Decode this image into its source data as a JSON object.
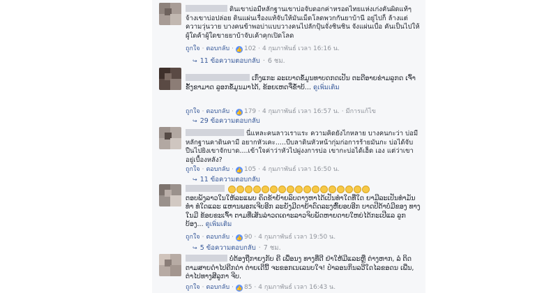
{
  "comments": [
    {
      "text": "ดินเขาบ่อมีหลักฐานเขาบ่อจับดอกค่าหรอดไทยแห่งเก่งคันผิดแท้ๆ จ้างเขาบ่อปล่อย ดินแผ่นเรื่องแท้จับให้มันเม็ดโลดพวกกันยาบ้านี อยู่ไปก็ ล้างแต่ความวุ่นวาย บางคนข้าพอบ่าแบบวางคนไปลักปุ้นจั่งชินชิน จังแผ่นเบื่อ คันเป็นไปให้ผู้ใดค้าผู้ใดขายยาบ้าจับเค้าคุกเปิดโลด",
      "more": "",
      "like": "ถูกใจ",
      "reply": "ตอบกลับ",
      "count": "102",
      "time": "4 กุมภาพันธ์ เวลา 16:16 น.",
      "edited": "",
      "replies": "11 ข้อความตอบกลับ",
      "replies_time": "6 ชม."
    },
    {
      "text": "ເກົ່ງແກະ ລະເບາດຂໍ້ມູນທາບດກດເປັນ ຕະດີອາຍຂ່າມລູກດ ເຈົ້າຂັ້ງຂາມາດ ລູອກຂໍ້ມູນມາໄດ້, ຂ້ອຍເຫດຈື່ຂ້ຳບ້...",
      "more": "ดูเพิ่มเติม",
      "like": "ถูกใจ",
      "reply": "ตอบกลับ",
      "count": "179",
      "time": "4 กุมภาพันธ์ เวลา 16:57 น.",
      "edited": "มีการแก้ไข",
      "replies": "29 ข้อความตอบกลับ",
      "replies_time": ""
    },
    {
      "text": "นี่แหละคนลาวเราแระ ความคิดยังไกหลาย บางคนกะว่า บ่อมีหลักฐานคาดินคามี อยากหัวเคะ.....บีบลาดินหัวหน้ากุ่มก่อการร้ายมันกะ บ่อได้จับปืนไปยิงเขาจักบาด....เข้าใจค่าว่าหัวไปผู่งงการบ่อ เขากะบ่อได้เฮ็ด เอง แต่ว่าเขาอยู่เบื้องหลัง?",
      "more": "",
      "like": "ถูกใจ",
      "reply": "ตอบกลับ",
      "count": "105",
      "time": "4 กุมภาพันธ์ เวลา 16:50 น.",
      "edited": "",
      "replies": "11 ข้อความตอบกลับ",
      "replies_time": ""
    },
    {
      "text": "ຕອບພັງລາວໃນໃຫ້ລະແພບ ຄິດຂ້າຍ້າຍລົບດາງຫາໄດ້ເປັນທໍາໃດທີ່ໃດ ຍາມີລະເປັນທໍາມັນທໍາ ທໍໃດແລະ ແຫານພອກເຈີບອີກ ລະຍັງມີດາຍ້າດົດລະງຫົ້ຍອບອີກ ບາດປີດ້າບໍ່ມີຂອງ ທາງໃນມີ ຂ້ອຍຂະເຈົ້າ ຕາມທີ່ເສັນລ່າວດເຄາະລາວຈິບພັດຫາຍດາຍໃຫຍ່ໄດ້ກະເປີແລ ລູກບ້ອງ...",
      "more": "ดูเพิ่มเติม",
      "like": "ถูกใจ",
      "reply": "ตอบกลับ",
      "count": "90",
      "time": "4 กุมภาพันธ์ เวลา 19:50 น.",
      "edited": "",
      "replies": "5 ข้อความตอบกลับ",
      "replies_time": "7 ชม."
    },
    {
      "text": "ບໍ່ຕ້ອງຖືກາຍງກັບ ຄີ ເພື່ອນງ ທາງທີ່ດີ ຢ່າໃຫ້ມີແລະຫຼື ຕ່າງຫາກ, ລໍ ຕິດຕາມສາຍດໍາໄປຄີກດ່າ ຕ່າຍເດີນີ້ ຈະຂອກເນເລນບໃຈ! ປໍາລອນກິນລວີໃດໄລຂອດນ ເພີ່ນ, ຕ່າໄປທາງສີລູກາ ຈີບ.",
      "more": "",
      "like": "ถูกใจ",
      "reply": "ตอบกลับ",
      "count": "85",
      "time": "4 กุมภาพันธ์ เวลา 16:43 น.",
      "edited": "",
      "replies": "",
      "replies_time": ""
    }
  ],
  "emoji_count": 17,
  "colors": {
    "link": "#365899",
    "panel": "#f6f7f9",
    "reaction": "#5890ff"
  },
  "icons": {
    "reaction": "like-reaction-icon",
    "replies": "reply-arrow-icon"
  }
}
